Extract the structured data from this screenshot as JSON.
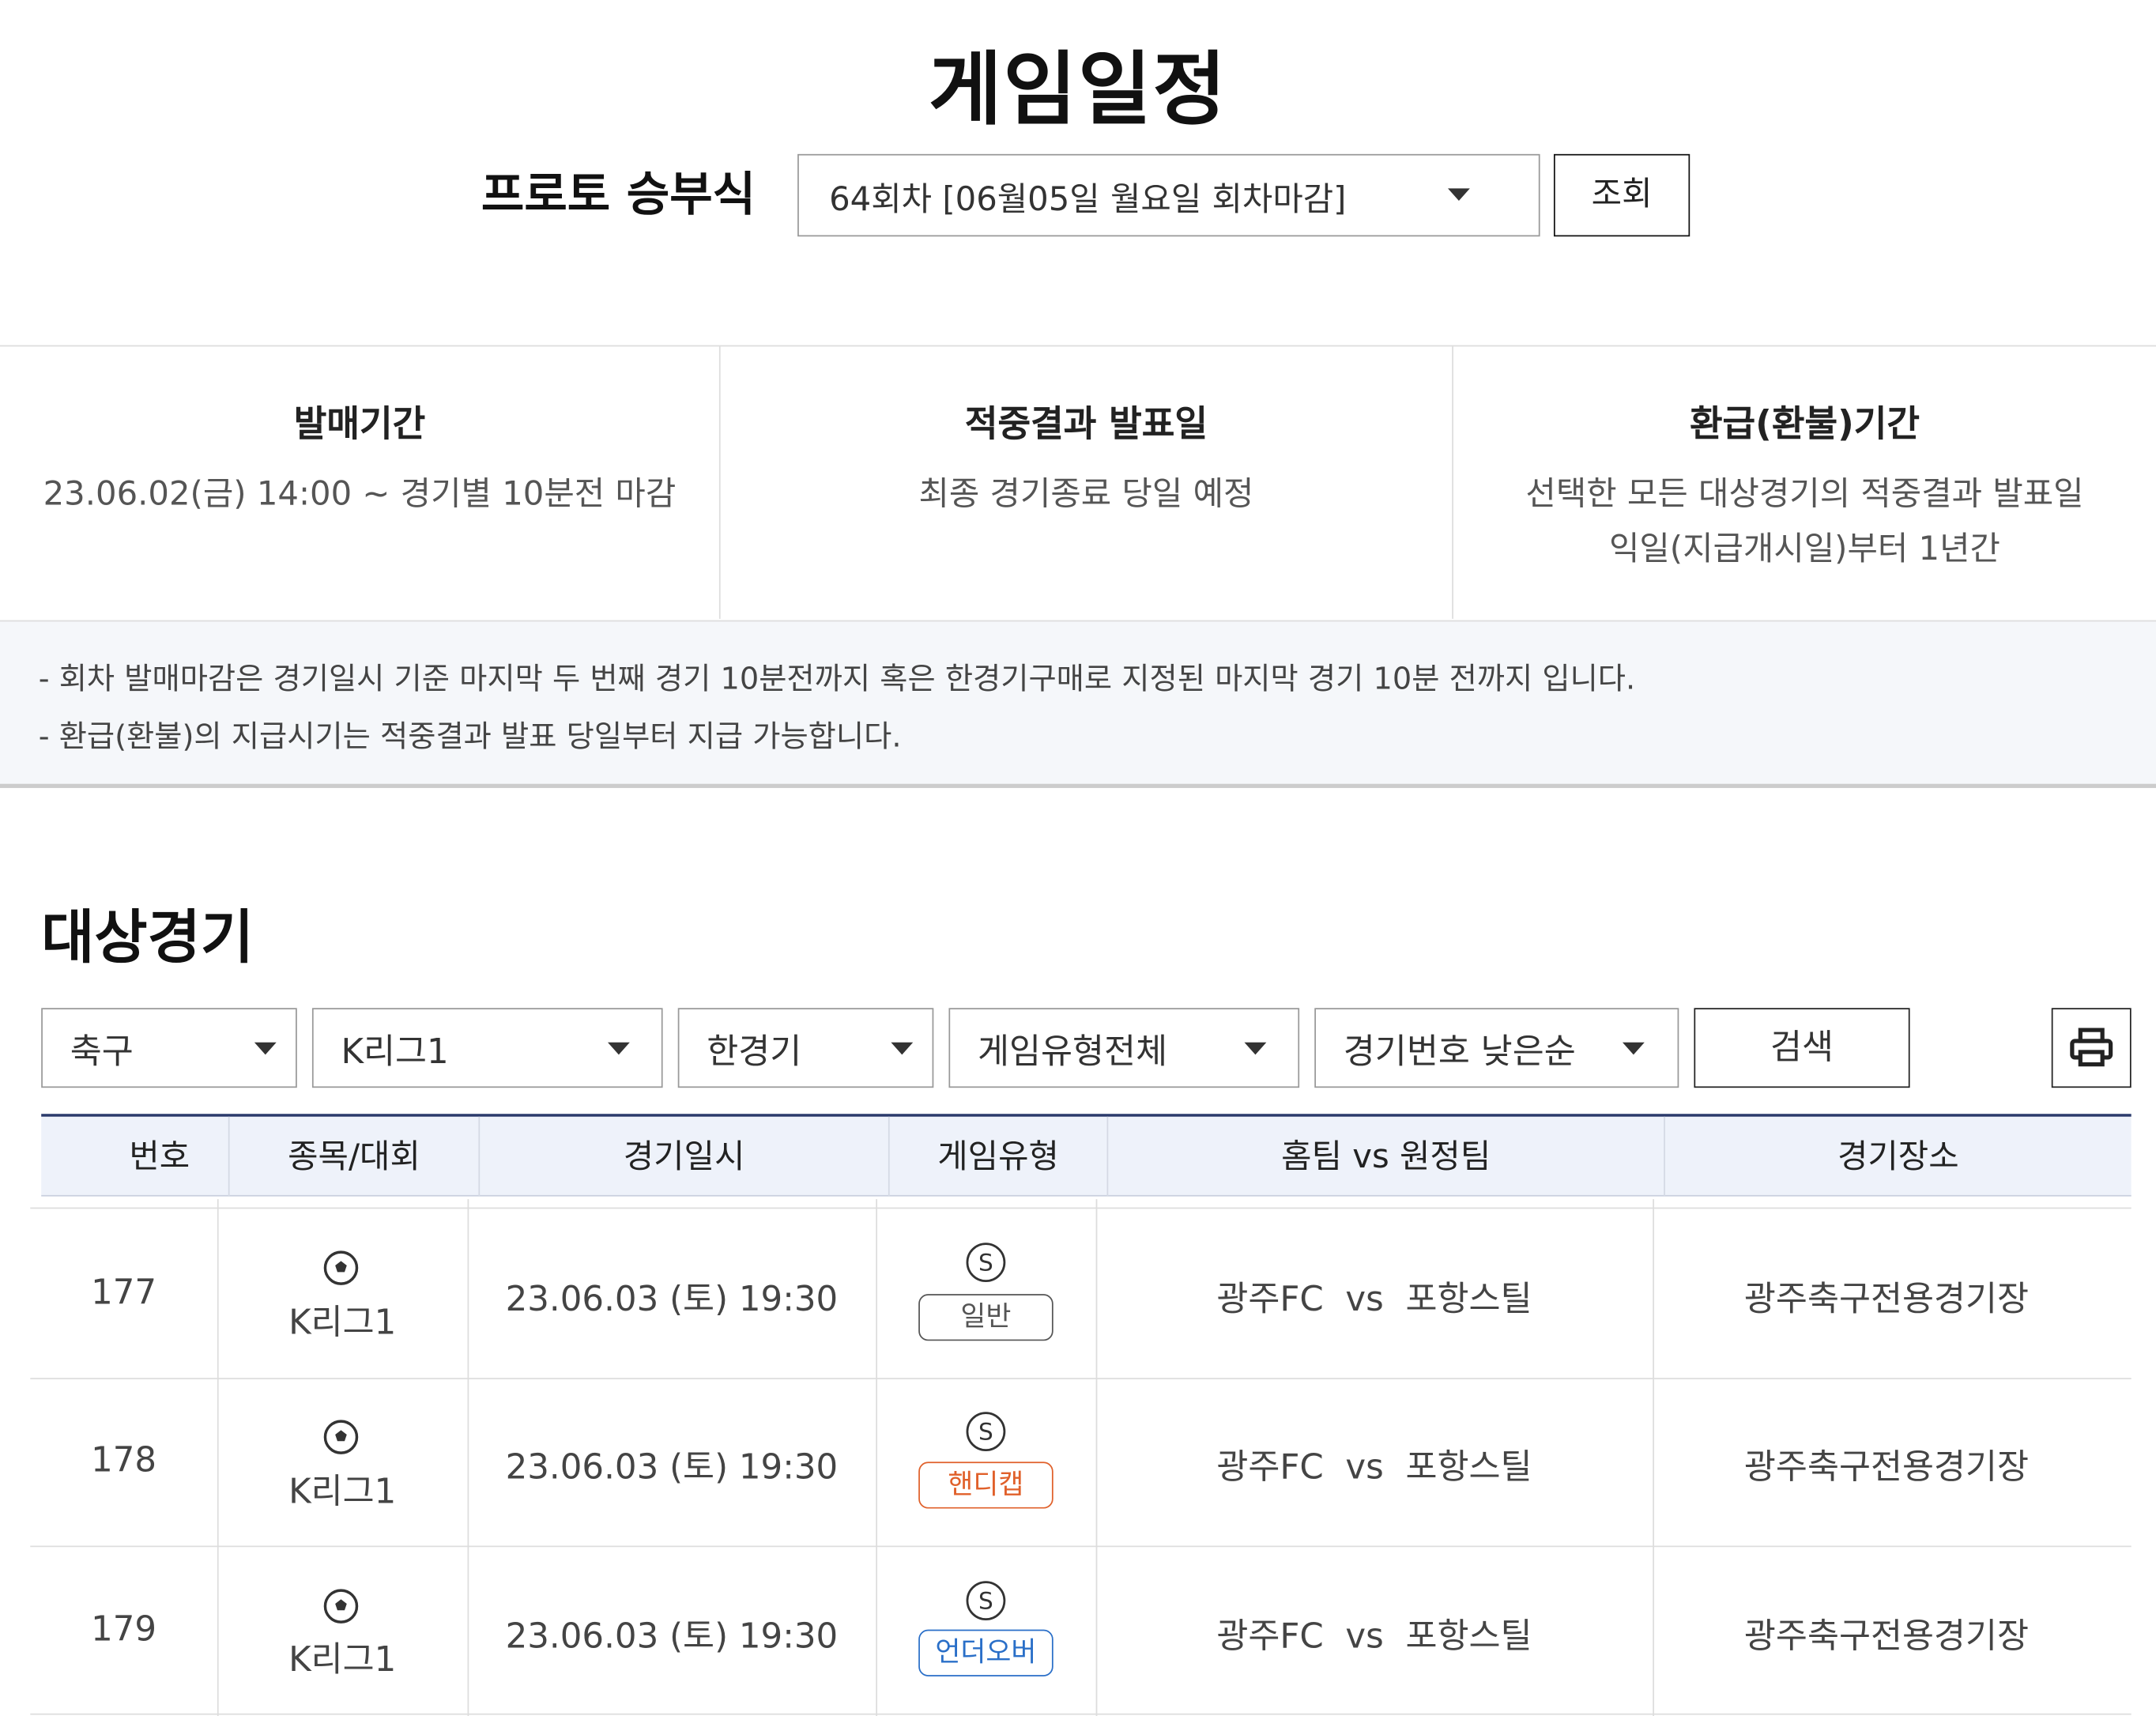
{
  "page": {
    "title": "게임일정"
  },
  "header": {
    "game_name": "프로토 승부식",
    "round_value": "64회차 [06월05일 월요일 회차마감]",
    "query_label": "조회"
  },
  "info": [
    {
      "title": "발매기간",
      "lines": [
        "23.06.02(금) 14:00 ~ 경기별 10분전 마감"
      ]
    },
    {
      "title": "적중결과 발표일",
      "lines": [
        "최종 경기종료 당일 예정"
      ]
    },
    {
      "title": "환급(환불)기간",
      "lines": [
        "선택한 모든 대상경기의 적중결과 발표일",
        "익일(지급개시일)부터 1년간"
      ]
    }
  ],
  "notice": [
    "- 회차 발매마감은 경기일시 기준 마지막 두 번째 경기 10분전까지 혹은 한경기구매로 지정된 마지막 경기 10분 전까지 입니다.",
    "- 환급(환불)의 지급시기는 적중결과 발표 당일부터 지급 가능합니다."
  ],
  "section": {
    "title": "대상경기"
  },
  "filters": {
    "sport": "축구",
    "league": "K리그1",
    "match_type": "한경기",
    "game_type": "게임유형전체",
    "sort": "경기번호 낮은순",
    "search_label": "검색"
  },
  "table": {
    "headers": [
      "번호",
      "종목/대회",
      "경기일시",
      "게임유형",
      "홈팀 vs 원정팀",
      "경기장소"
    ],
    "rows": [
      {
        "no": "177",
        "icon": "soccer-ball-icon",
        "league": "K리그1",
        "datetime": "23.06.03 (토) 19:30",
        "type_icon": "S",
        "type": "일반",
        "type_color": "#555555",
        "match": "광주FC  vs  포항스틸",
        "venue": "광주축구전용경기장"
      },
      {
        "no": "178",
        "icon": "soccer-ball-icon",
        "league": "K리그1",
        "datetime": "23.06.03 (토) 19:30",
        "type_icon": "S",
        "type": "핸디캡",
        "type_color": "#e0602a",
        "match": "광주FC  vs  포항스틸",
        "venue": "광주축구전용경기장"
      },
      {
        "no": "179",
        "icon": "soccer-ball-icon",
        "league": "K리그1",
        "datetime": "23.06.03 (토) 19:30",
        "type_icon": "S",
        "type": "언더오버",
        "type_color": "#2a6fc8",
        "match": "광주FC  vs  포항스틸",
        "venue": "광주축구전용경기장"
      }
    ]
  },
  "colors": {
    "header_bg": "#eef2fa",
    "header_border": "#2b3a6b",
    "notice_bg": "#f5f7fa"
  }
}
